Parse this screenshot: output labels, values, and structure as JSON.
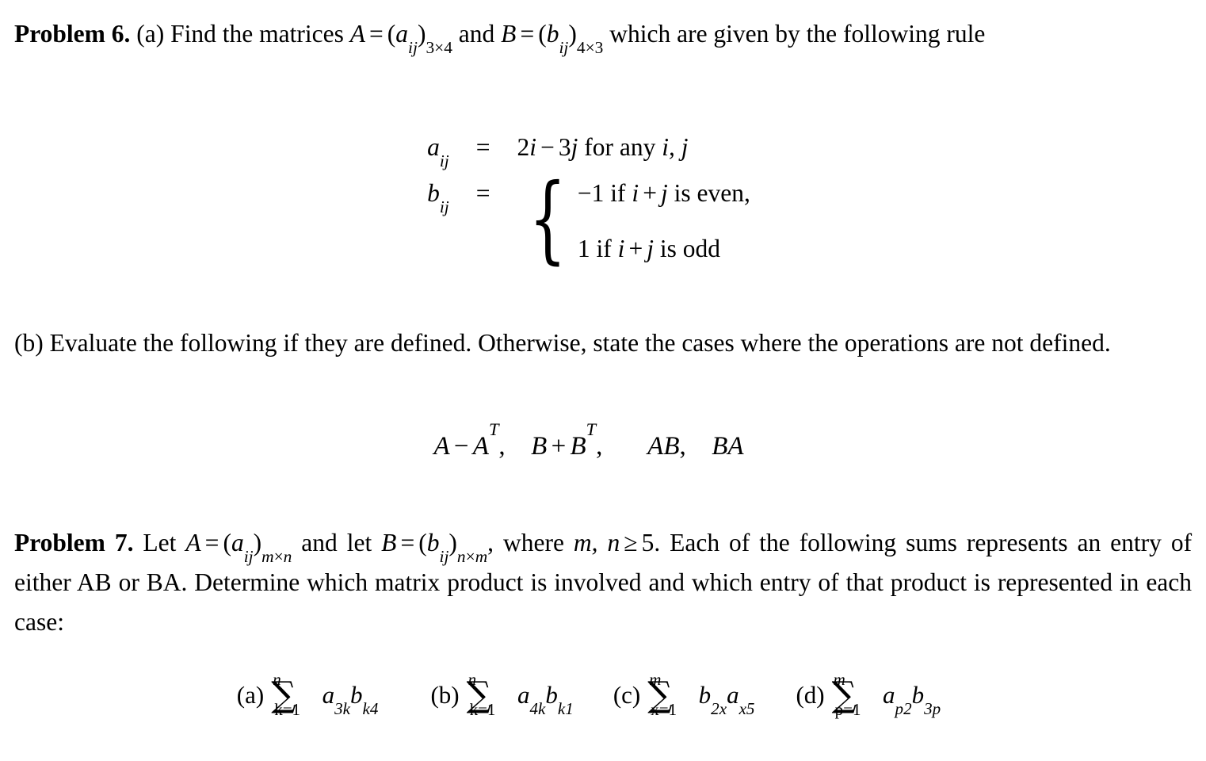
{
  "document": {
    "type": "math-worksheet",
    "background_color": "#ffffff",
    "text_color": "#000000"
  },
  "problem6": {
    "label": "Problem 6.",
    "part_a_marker": "(a)",
    "intro_1": "Find the matrices",
    "matrix_a": {
      "name": "A",
      "eq": "=",
      "entry_open": "(",
      "entry_base": "a",
      "entry_sub": "ij",
      "entry_close": ")",
      "dim": "3×4"
    },
    "conj": "and",
    "matrix_b": {
      "name": "B",
      "eq": "=",
      "entry_open": "(",
      "entry_base": "b",
      "entry_sub": "ij",
      "entry_close": ")",
      "dim": "4×3"
    },
    "intro_2": "which are given by",
    "intro_3": "the following rule",
    "definitions": {
      "a_rule": {
        "lhs_base": "a",
        "lhs_sub": "ij",
        "relation": "=",
        "rhs": "2i − 3j for any i, j",
        "rhs_parts": {
          "two": "2",
          "i": "i",
          "minus": "−",
          "three": "3",
          "j": "j",
          "text": "for any",
          "vars": "i, j"
        }
      },
      "b_rule": {
        "lhs_base": "b",
        "lhs_sub": "ij",
        "relation": "=",
        "case_1": {
          "value": "−1",
          "text": "if i + j is even,",
          "cond_lead": "if",
          "cond_i": "i",
          "cond_plus": "+",
          "cond_j": "j",
          "cond_tail": "is even,"
        },
        "case_2": {
          "value": "1",
          "text": "if i + j is odd",
          "cond_lead": "if",
          "cond_i": "i",
          "cond_plus": "+",
          "cond_j": "j",
          "cond_tail": "is odd"
        }
      }
    },
    "part_b_marker": "(b)",
    "part_b_text_1": "Evaluate the following if they are defined.",
    "part_b_text_2": "Otherwise, state the cases where the",
    "part_b_text_3": "operations are not defined.",
    "expressions": {
      "expr_1": {
        "left": "A",
        "op": "−",
        "right": "A",
        "sup": "T"
      },
      "comma_1": ",",
      "expr_2": {
        "left": "B",
        "op": "+",
        "right": "B",
        "sup": "T"
      },
      "comma_2": ",",
      "expr_3": "AB",
      "comma_3": ",",
      "expr_4": "BA"
    }
  },
  "problem7": {
    "label": "Problem 7.",
    "lead": "Let",
    "matrix_a": {
      "name": "A",
      "eq": "=",
      "entry_open": "(",
      "entry_base": "a",
      "entry_sub": "ij",
      "entry_close": ")",
      "dim_m": "m",
      "dim_times": "×",
      "dim_n": "n"
    },
    "mid": "and let",
    "matrix_b": {
      "name": "B",
      "eq": "=",
      "entry_open": "(",
      "entry_base": "b",
      "entry_sub": "ij",
      "entry_close": ")",
      "dim_n": "n",
      "dim_times": "×",
      "dim_m": "m",
      "comma": ","
    },
    "where_text": "where",
    "condition_vars": "m, n",
    "condition_rel": "≥",
    "condition_val": "5.",
    "tail_1": "Each of the",
    "line_2": "following sums represents an entry of either AB or BA. Determine which matrix product",
    "line_3": "is involved and which entry of that product is represented in each case:",
    "sums": [
      {
        "tag": "(a)",
        "sigma": "∑",
        "upper": "n",
        "lower": "k=1",
        "body_first_base": "a",
        "body_first_sub": "3k",
        "body_second_base": "b",
        "body_second_sub": "k4"
      },
      {
        "tag": "(b)",
        "sigma": "∑",
        "upper": "n",
        "lower": "k=1",
        "body_first_base": "a",
        "body_first_sub": "4k",
        "body_second_base": "b",
        "body_second_sub": "k1"
      },
      {
        "tag": "(c)",
        "sigma": "∑",
        "upper": "m",
        "lower": "x=1",
        "body_first_base": "b",
        "body_first_sub": "2x",
        "body_second_base": "a",
        "body_second_sub": "x5"
      },
      {
        "tag": "(d)",
        "sigma": "∑",
        "upper": "m",
        "lower": "p=1",
        "body_first_base": "a",
        "body_first_sub": "p2",
        "body_second_base": "b",
        "body_second_sub": "3p"
      }
    ]
  }
}
